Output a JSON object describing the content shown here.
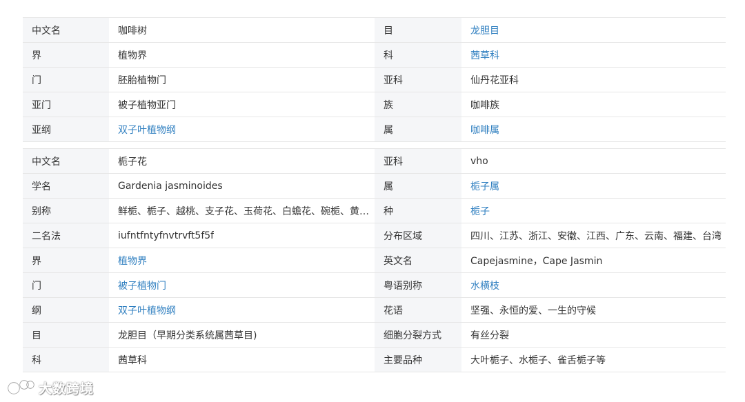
{
  "table1": [
    {
      "k1": "中文名",
      "v1": "咖啡树",
      "v1_link": false,
      "k2": "目",
      "v2": "龙胆目",
      "v2_link": true
    },
    {
      "k1": "界",
      "v1": "植物界",
      "v1_link": false,
      "k2": "科",
      "v2": "茜草科",
      "v2_link": true
    },
    {
      "k1": "门",
      "v1": "胚胎植物门",
      "v1_link": false,
      "k2": "亚科",
      "v2": "仙丹花亚科",
      "v2_link": false
    },
    {
      "k1": "亚门",
      "v1": "被子植物亚门",
      "v1_link": false,
      "k2": "族",
      "v2": "咖啡族",
      "v2_link": false
    },
    {
      "k1": "亚纲",
      "v1": "双子叶植物纲",
      "v1_link": true,
      "k2": "属",
      "v2": "咖啡属",
      "v2_link": true
    }
  ],
  "table2": [
    {
      "k1": "中文名",
      "v1": "栀子花",
      "v1_link": false,
      "k2": "亚科",
      "v2": "vho",
      "v2_link": false
    },
    {
      "k1": "学名",
      "v1": "Gardenia jasminoides",
      "v1_link": false,
      "k2": "属",
      "v2": "栀子属",
      "v2_link": true
    },
    {
      "k1": "别称",
      "v1": "鲜栀、栀子、越桃、支子花、玉荷花、白蟾花、碗栀、黄栀子、山栀子",
      "v1_link": false,
      "k2": "种",
      "v2": "栀子",
      "v2_link": true
    },
    {
      "k1": "二名法",
      "v1": "iufntfntyfnvtrvft5f5f",
      "v1_link": false,
      "k2": "分布区域",
      "v2": "四川、江苏、浙江、安徽、江西、广东、云南、福建、台湾",
      "v2_link": false
    },
    {
      "k1": "界",
      "v1": "植物界",
      "v1_link": true,
      "k2": "英文名",
      "v2": "Capejasmine，Cape Jasmin",
      "v2_link": false
    },
    {
      "k1": "门",
      "v1": "被子植物门",
      "v1_link": true,
      "k2": "粤语别称",
      "v2": "水横枝",
      "v2_link": true
    },
    {
      "k1": "纲",
      "v1": "双子叶植物纲",
      "v1_link": true,
      "k2": "花语",
      "v2": "坚强、永恒的爱、一生的守候",
      "v2_link": false
    },
    {
      "k1": "目",
      "v1": "龙胆目（早期分类系统属茜草目)",
      "v1_link": false,
      "k2": "细胞分裂方式",
      "v2": "有丝分裂",
      "v2_link": false
    },
    {
      "k1": "科",
      "v1": "茜草科",
      "v1_link": false,
      "k2": "主要品种",
      "v2": "大叶栀子、水栀子、雀舌栀子等",
      "v2_link": false
    }
  ],
  "watermark": {
    "text": "大数跨境",
    "icon": "logo-icon"
  },
  "colors": {
    "link": "#2f7fc0",
    "header_bg": "#f5f6f8",
    "border": "#e6e6e6"
  }
}
